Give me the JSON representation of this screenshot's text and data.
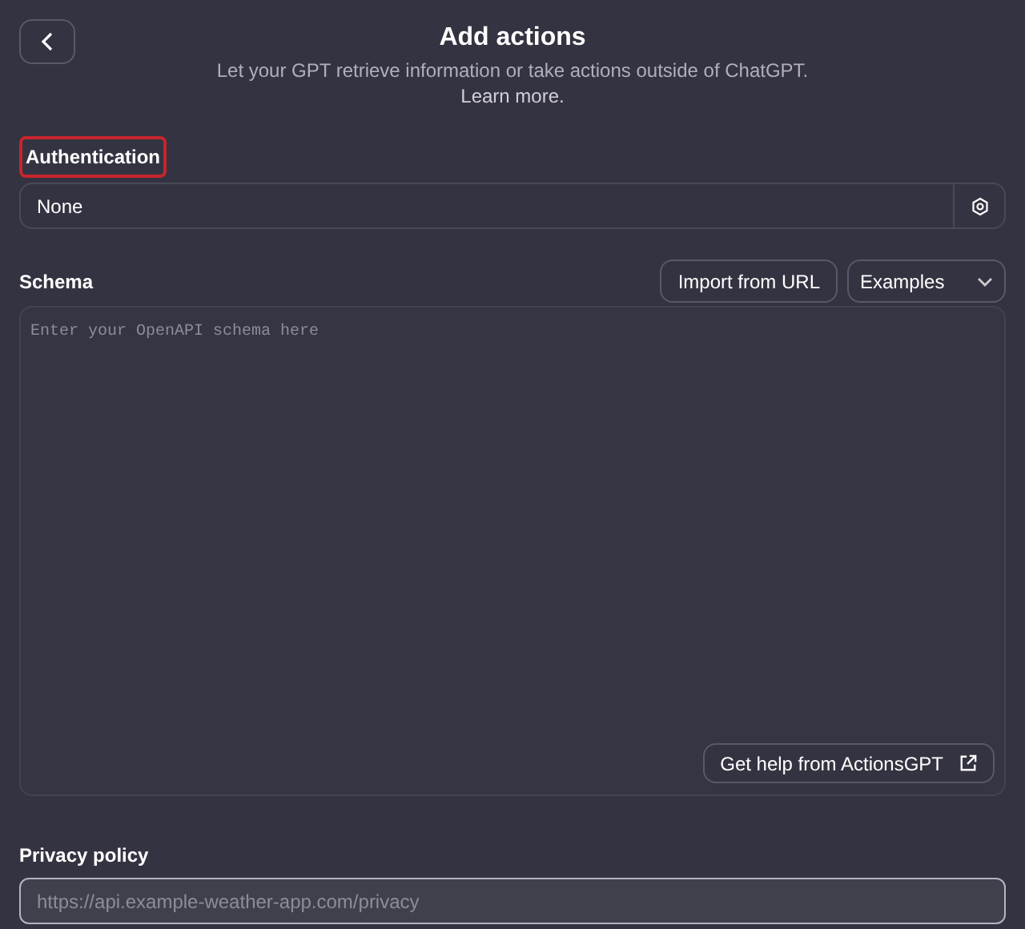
{
  "header": {
    "title": "Add actions",
    "subtitle": "Let your GPT retrieve information or take actions outside of ChatGPT.",
    "link": "Learn more."
  },
  "authentication": {
    "label": "Authentication",
    "highlighted": true,
    "value": "None"
  },
  "schema": {
    "label": "Schema",
    "import_button": "Import from URL",
    "examples_dropdown": "Examples",
    "placeholder": "Enter your OpenAPI schema here",
    "help_button": "Get help from ActionsGPT"
  },
  "privacy_policy": {
    "label": "Privacy policy",
    "placeholder": "https://api.example-weather-app.com/privacy",
    "focused": true
  }
}
